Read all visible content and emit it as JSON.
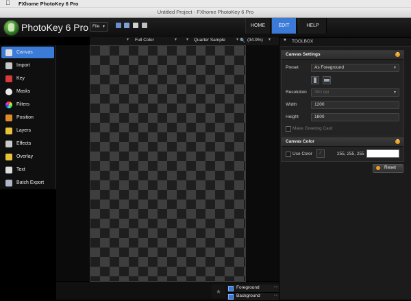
{
  "menubar": {
    "app_name": "FXhome PhotoKey 6 Pro"
  },
  "window": {
    "title": "Untitled Project - FXhome PhotoKey 6 Pro"
  },
  "toolbar": {
    "logo_text": "PhotoKey 6 Pro",
    "file_label": "File",
    "nav": [
      {
        "label": "HOME"
      },
      {
        "label": "EDIT",
        "active": true
      },
      {
        "label": "HELP"
      }
    ]
  },
  "viewbar": {
    "color_mode": "Full Color",
    "sample_mode": "Quarter Sample",
    "zoom": "(34.9%)"
  },
  "sidebar": {
    "items": [
      {
        "label": "Canvas",
        "icon": "canvas-icon",
        "active": true
      },
      {
        "label": "Import",
        "icon": "import-icon"
      },
      {
        "label": "Key",
        "icon": "key-icon"
      },
      {
        "label": "Masks",
        "icon": "masks-icon"
      },
      {
        "label": "Filters",
        "icon": "filters-icon"
      },
      {
        "label": "Position",
        "icon": "position-icon"
      },
      {
        "label": "Layers",
        "icon": "layers-icon"
      },
      {
        "label": "Effects",
        "icon": "effects-icon"
      },
      {
        "label": "Overlay",
        "icon": "overlay-icon"
      },
      {
        "label": "Text",
        "icon": "text-icon"
      },
      {
        "label": "Batch Export",
        "icon": "batch-export-icon"
      }
    ]
  },
  "layers": [
    {
      "label": "Foreground",
      "checked": true
    },
    {
      "label": "Background",
      "checked": true
    }
  ],
  "toolbox": {
    "title": "TOOLBOX",
    "canvas_settings": {
      "title": "Canvas Settings",
      "preset_label": "Preset",
      "preset_value": "As Foreground",
      "resolution_label": "Resolution",
      "resolution_value": "300 dpi",
      "width_label": "Width",
      "width_value": "1200",
      "height_label": "Height",
      "height_value": "1800",
      "greeting_label": "Make Greeting Card"
    },
    "canvas_color": {
      "title": "Canvas Color",
      "use_color_label": "Use Color",
      "rgb_value": "255, 255, 255",
      "swatch_color": "#ffffff"
    },
    "reset_label": "Reset"
  },
  "colors": {
    "accent": "#3b7ad6",
    "help": "#f0a020"
  }
}
